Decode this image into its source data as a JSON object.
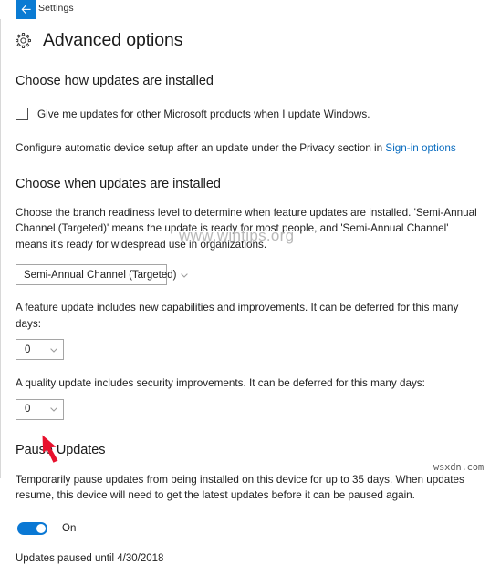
{
  "titlebar": {
    "back_icon": "arrow-left-icon",
    "title": "Settings",
    "accent_color": "#0a7bd3"
  },
  "header": {
    "icon": "gear-icon",
    "title": "Advanced options"
  },
  "sections": {
    "how_installed": {
      "heading": "Choose how updates are installed",
      "checkbox": {
        "label": "Give me updates for other Microsoft products when I update Windows.",
        "checked": false
      },
      "note_prefix": "Configure automatic device setup after an update under the Privacy section in ",
      "note_link": "Sign-in options",
      "link_color": "#0a6cbf"
    },
    "when_installed": {
      "heading": "Choose when updates are installed",
      "description": "Choose the branch readiness level to determine when feature updates are installed. 'Semi-Annual Channel (Targeted)' means the update is ready for most people, and 'Semi-Annual Channel' means it's ready for widespread use in organizations.",
      "branch_dropdown": {
        "value": "Semi-Annual Channel (Targeted)",
        "chevron": "chevron-down-icon"
      },
      "feature_label": "A feature update includes new capabilities and improvements. It can be deferred for this many days:",
      "feature_dropdown": {
        "value": "0",
        "chevron": "chevron-down-icon"
      },
      "quality_label": "A quality update includes security improvements. It can be deferred for this many days:",
      "quality_dropdown": {
        "value": "0",
        "chevron": "chevron-down-icon"
      }
    },
    "pause_updates": {
      "heading": "Pause Updates",
      "description": "Temporarily pause updates from being installed on this device for up to 35 days. When updates resume, this device will need to get the latest updates before it can be paused again.",
      "toggle": {
        "state_label": "On",
        "on": true,
        "on_color": "#0a78d4"
      },
      "paused_until": "Updates paused until  4/30/2018"
    }
  },
  "annotations": {
    "arrow_color": "#e8112d",
    "arrow_name": "red-pointer-arrow"
  },
  "watermarks": {
    "center": "www.wintips.org",
    "corner": "wsxdn.com"
  }
}
